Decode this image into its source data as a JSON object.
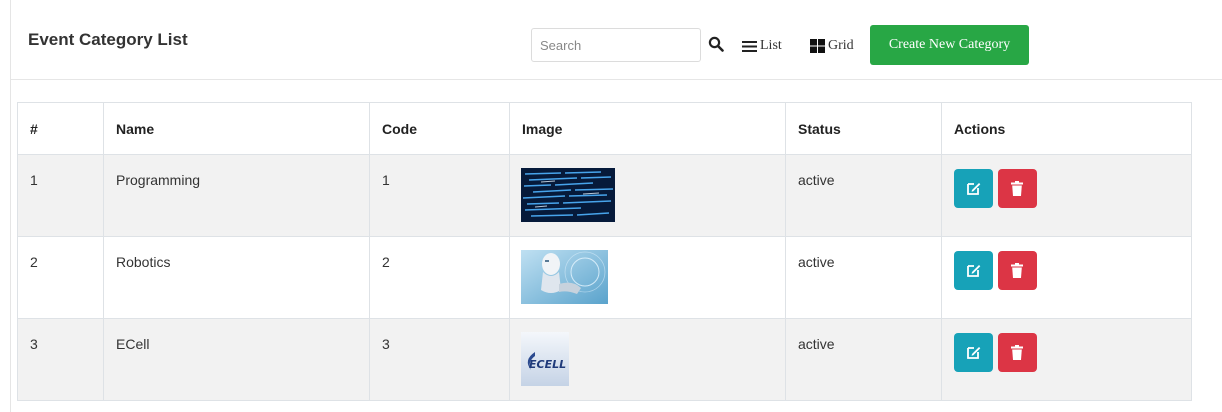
{
  "header": {
    "title": "Event Category List",
    "search_placeholder": "Search",
    "list_label": "List",
    "grid_label": "Grid",
    "create_label": "Create New Category"
  },
  "table": {
    "columns": [
      "#",
      "Name",
      "Code",
      "Image",
      "Status",
      "Actions"
    ],
    "rows": [
      {
        "num": "1",
        "name": "Programming",
        "code": "1",
        "status": "active",
        "image": "code-screen-thumbnail"
      },
      {
        "num": "2",
        "name": "Robotics",
        "code": "2",
        "status": "active",
        "image": "robot-thumbnail"
      },
      {
        "num": "3",
        "name": "ECell",
        "code": "3",
        "status": "active",
        "image": "ecell-logo-thumbnail",
        "logo_text": "ECELL"
      }
    ]
  },
  "colors": {
    "create_button": "#28a745",
    "edit_button": "#17a2b8",
    "delete_button": "#dc3545",
    "striped_row": "#f2f2f2"
  }
}
